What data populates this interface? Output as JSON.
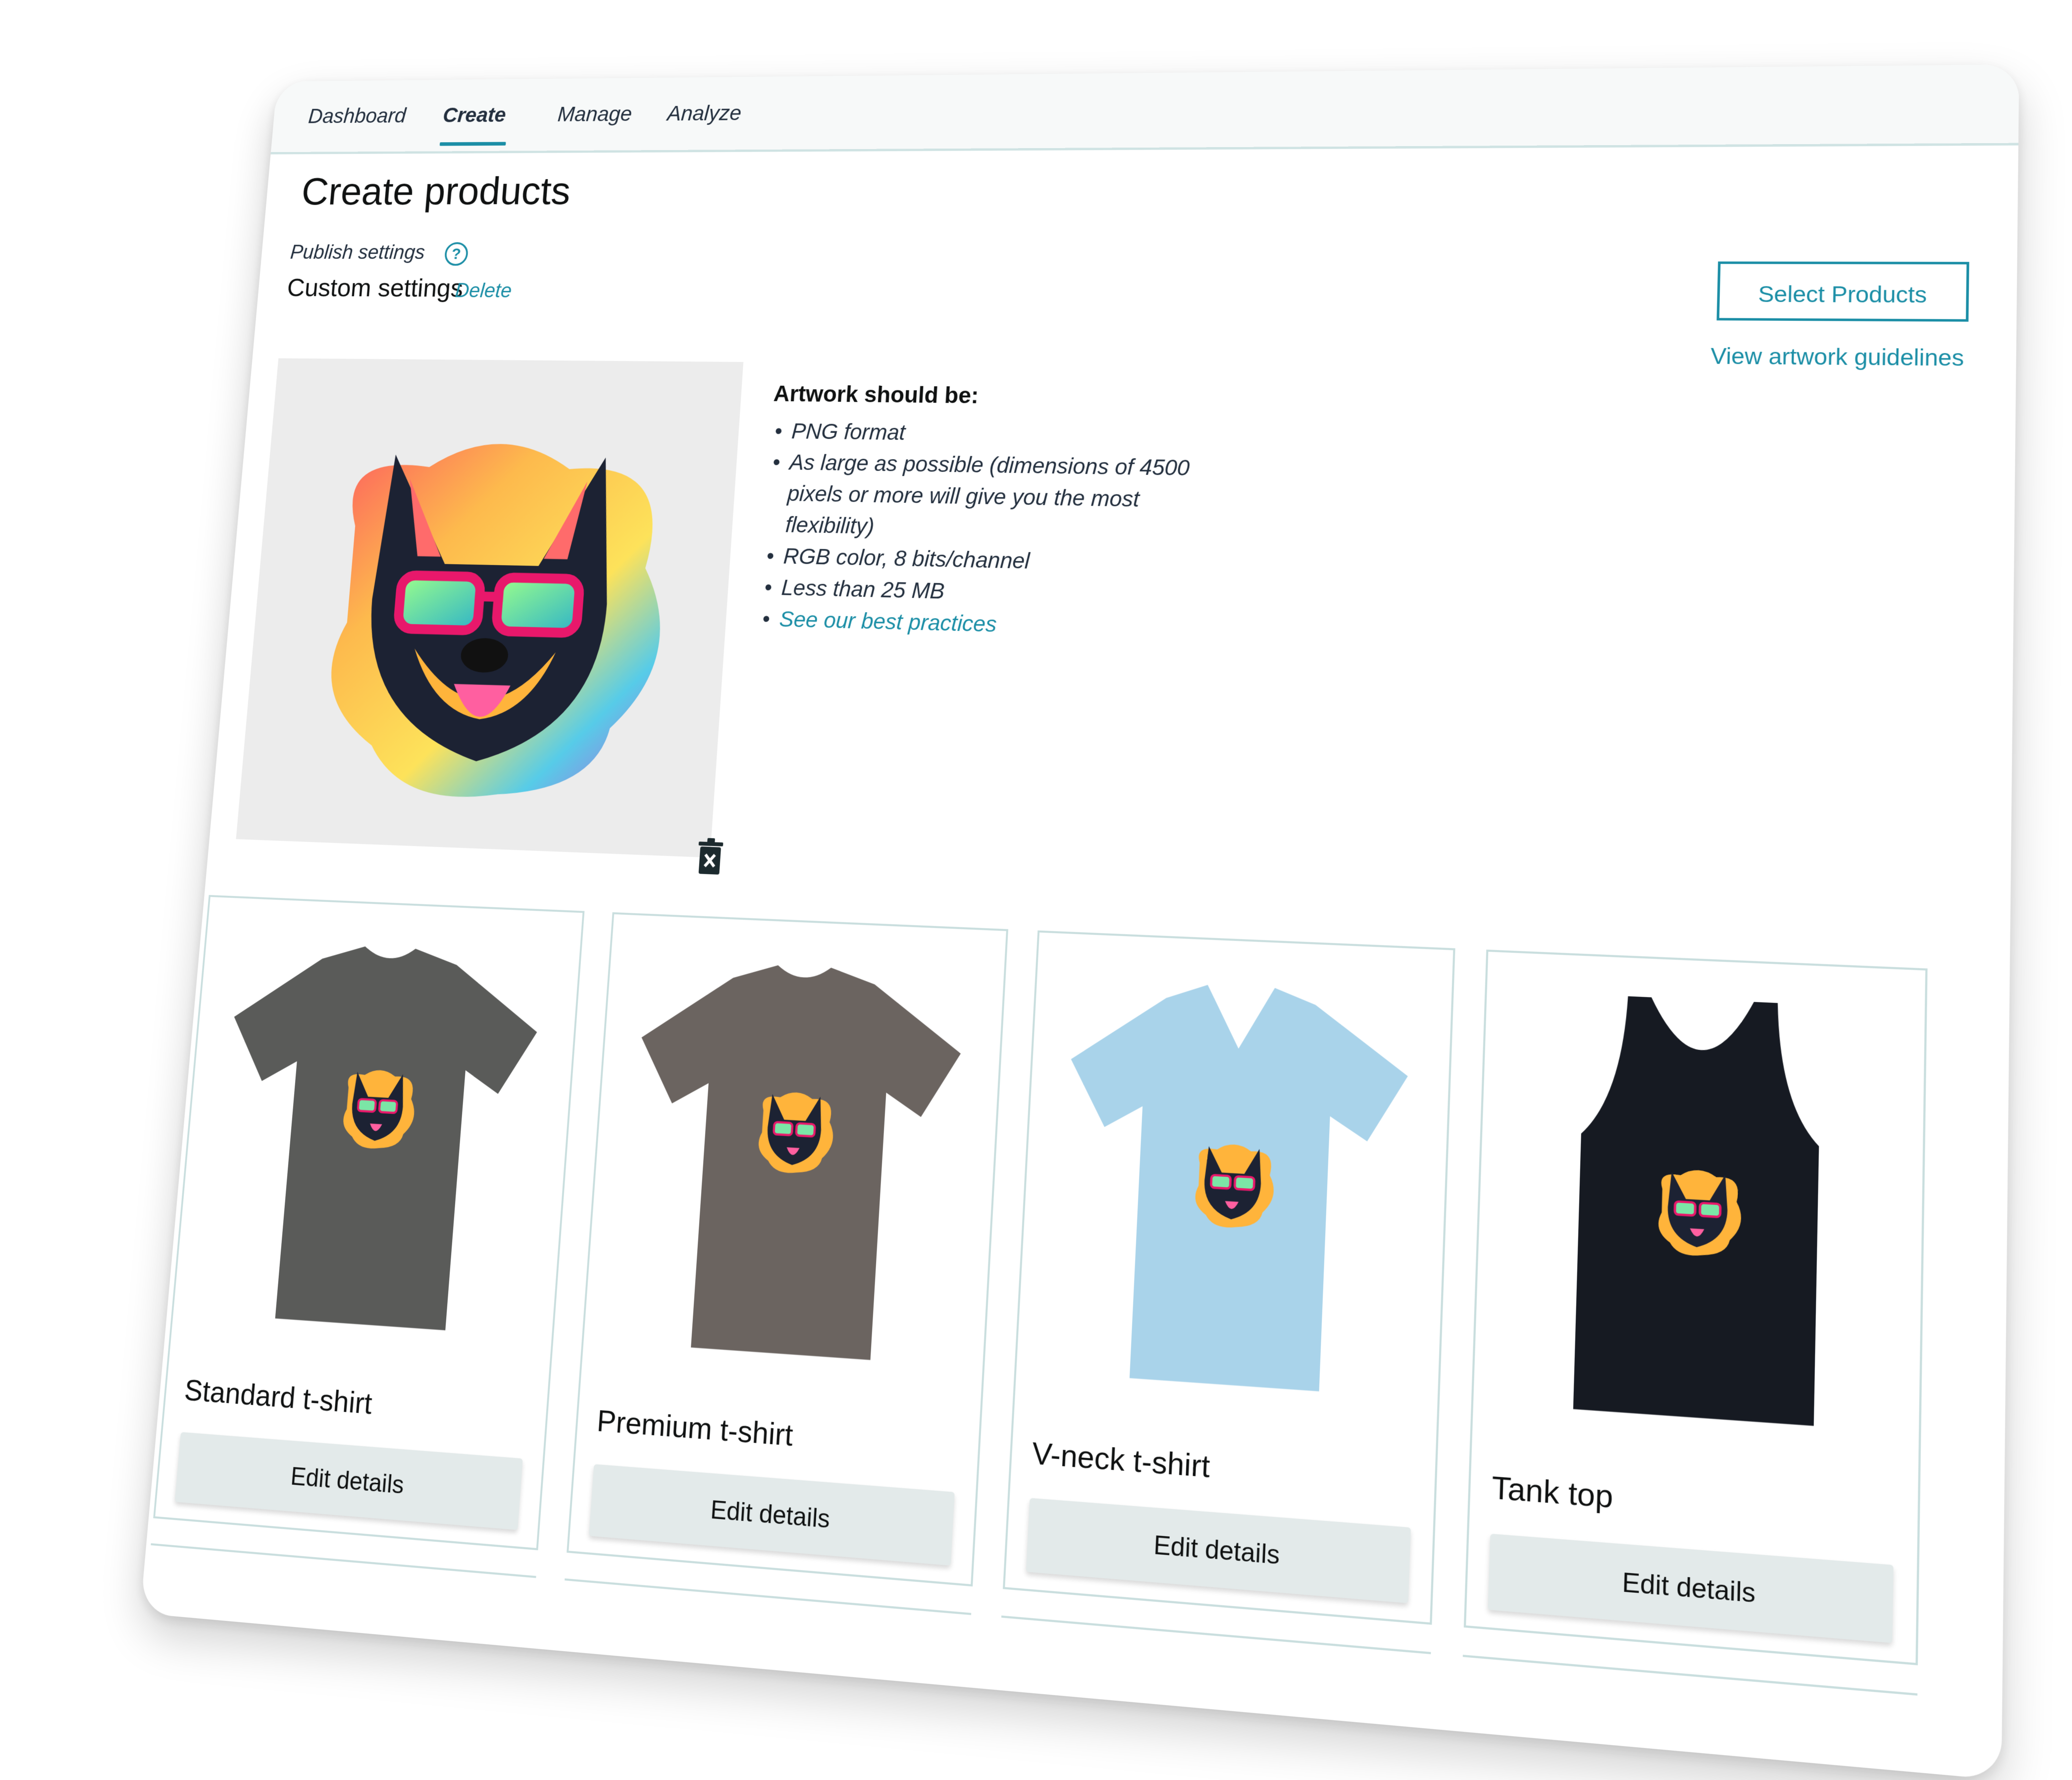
{
  "tabs": [
    {
      "label": "Dashboard"
    },
    {
      "label": "Create"
    },
    {
      "label": "Manage"
    },
    {
      "label": "Analyze"
    }
  ],
  "page": {
    "title": "Create products",
    "publish_label": "Publish settings",
    "settings_name": "Custom settings",
    "delete_label": "Delete",
    "select_products_label": "Select Products",
    "guidelines_label": "View artwork guidelines"
  },
  "requirements": {
    "title": "Artwork should be:",
    "items": [
      "PNG format",
      "As large as possible (dimensions of 4500 pixels or more will give you the most flexibility)",
      "RGB color, 8 bits/channel",
      "Less than 25 MB"
    ],
    "link": "See our best practices"
  },
  "products": [
    {
      "name": "Standard t-shirt",
      "button": "Edit details",
      "color": "#5a5b59",
      "style": "crew"
    },
    {
      "name": "Premium t-shirt",
      "button": "Edit details",
      "color": "#6b6460",
      "style": "crew"
    },
    {
      "name": "V-neck t-shirt",
      "button": "Edit details",
      "color": "#a9d3ea",
      "style": "vneck"
    },
    {
      "name": "Tank top",
      "button": "Edit details",
      "color": "#161a22",
      "style": "tank"
    }
  ],
  "colors": {
    "accent": "#1b8ea6",
    "button_bg": "#e3eaea",
    "border": "#c9dede"
  }
}
